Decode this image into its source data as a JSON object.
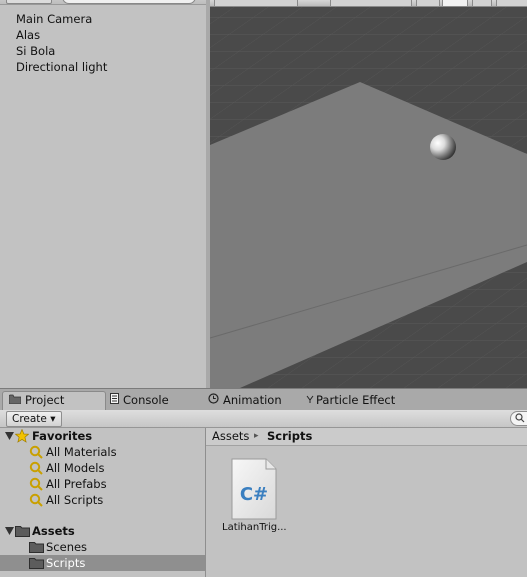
{
  "hierarchy": {
    "items": [
      "Main Camera",
      "Alas",
      "Si Bola",
      "Directional light"
    ]
  },
  "tabs": [
    {
      "label": "Project",
      "icon": "folder-icon",
      "active": true
    },
    {
      "label": "Console",
      "icon": "console-icon",
      "active": false
    },
    {
      "label": "Animation",
      "icon": "animation-clock-icon",
      "active": false
    },
    {
      "label": "Particle Effect",
      "icon": "particle-icon",
      "active": false
    }
  ],
  "project": {
    "create_label": "Create ▾",
    "favorites": {
      "label": "Favorites",
      "items": [
        "All Materials",
        "All Models",
        "All Prefabs",
        "All Scripts"
      ]
    },
    "assets": {
      "label": "Assets",
      "folders": [
        "Scenes",
        "Scripts"
      ],
      "selected": "Scripts"
    },
    "breadcrumb": {
      "root": "Assets",
      "separator": "▸",
      "current": "Scripts"
    },
    "files": [
      {
        "name": "LatihanTrig...",
        "type": "csharp-script",
        "icon_text": "C#"
      }
    ]
  },
  "colors": {
    "panel_bg": "#c2c2c2",
    "selected_row": "#8f8f8f",
    "scene_grid_bg": "#4a4a4a",
    "scene_plane": "#7c7c7c",
    "favorites_star": "#f2c200",
    "csharp_accent": "#3a7fc0"
  }
}
